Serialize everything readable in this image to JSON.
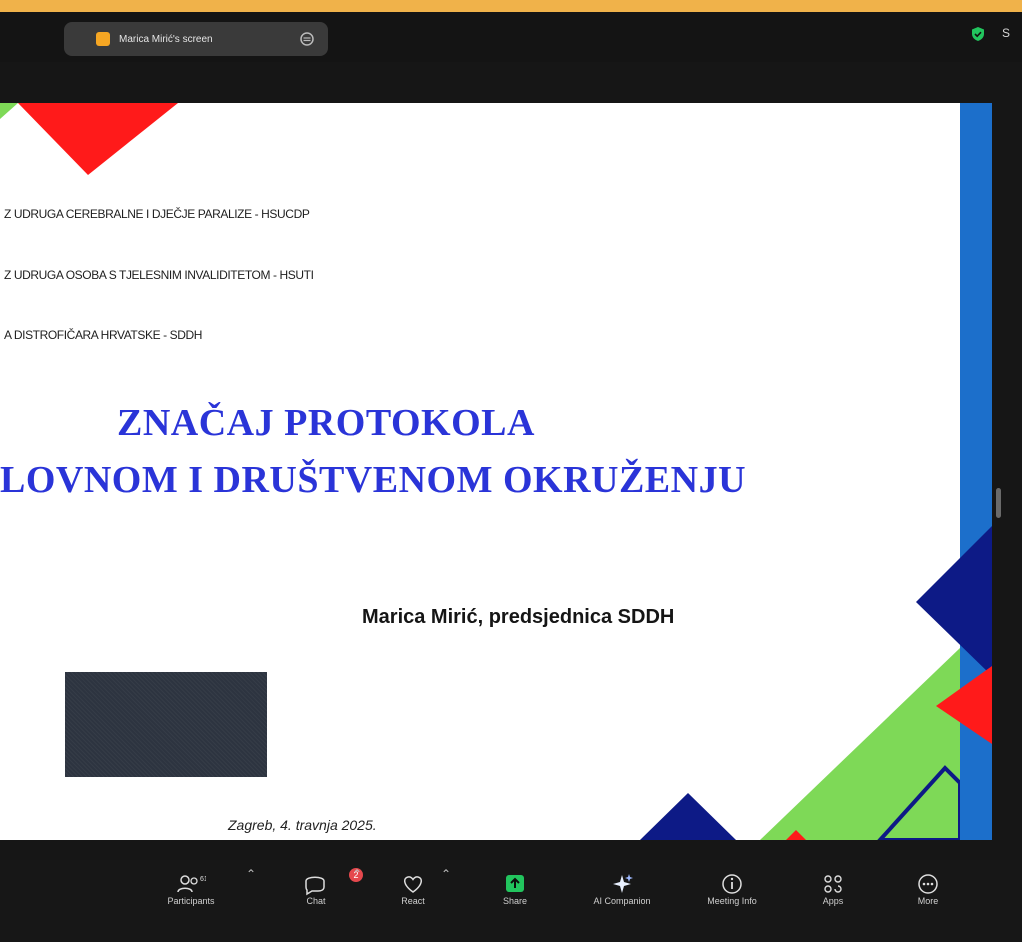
{
  "topbar": {
    "screen_label": "Marica Mirić's screen",
    "right_text": "S"
  },
  "slide": {
    "org_lines": [
      "Z UDRUGA CEREBRALNE I DJEČJE PARALIZE - HSUCDP",
      "Z UDRUGA OSOBA S TJELESNIM INVALIDITETOM - HSUTI",
      "A DISTROFIČARA HRVATSKE - SDDH"
    ],
    "title_line1": "ZNAČAJ PROTOKOLA",
    "title_line2": "LOVNOM I DRUŠTVENOM OKRUŽENJU",
    "author": "Marica Mirić, predsjednica SDDH",
    "date": "Zagreb, 4. travnja 2025."
  },
  "toolbar": {
    "participants_label": "Participants",
    "participants_count": "61",
    "chat_label": "Chat",
    "chat_badge": "2",
    "react_label": "React",
    "share_label": "Share",
    "ai_label": "AI Companion",
    "meeting_info_label": "Meeting Info",
    "apps_label": "Apps",
    "more_label": "More"
  },
  "colors": {
    "accent_top": "#f0b24a",
    "title_blue": "#2a34d8",
    "share_green": "#22c55e",
    "badge_red": "#e5484d",
    "deco_red": "#ff1a1a",
    "deco_navy": "#0d1a86",
    "deco_green": "#7ed957",
    "deco_blue": "#1c6fcb"
  }
}
